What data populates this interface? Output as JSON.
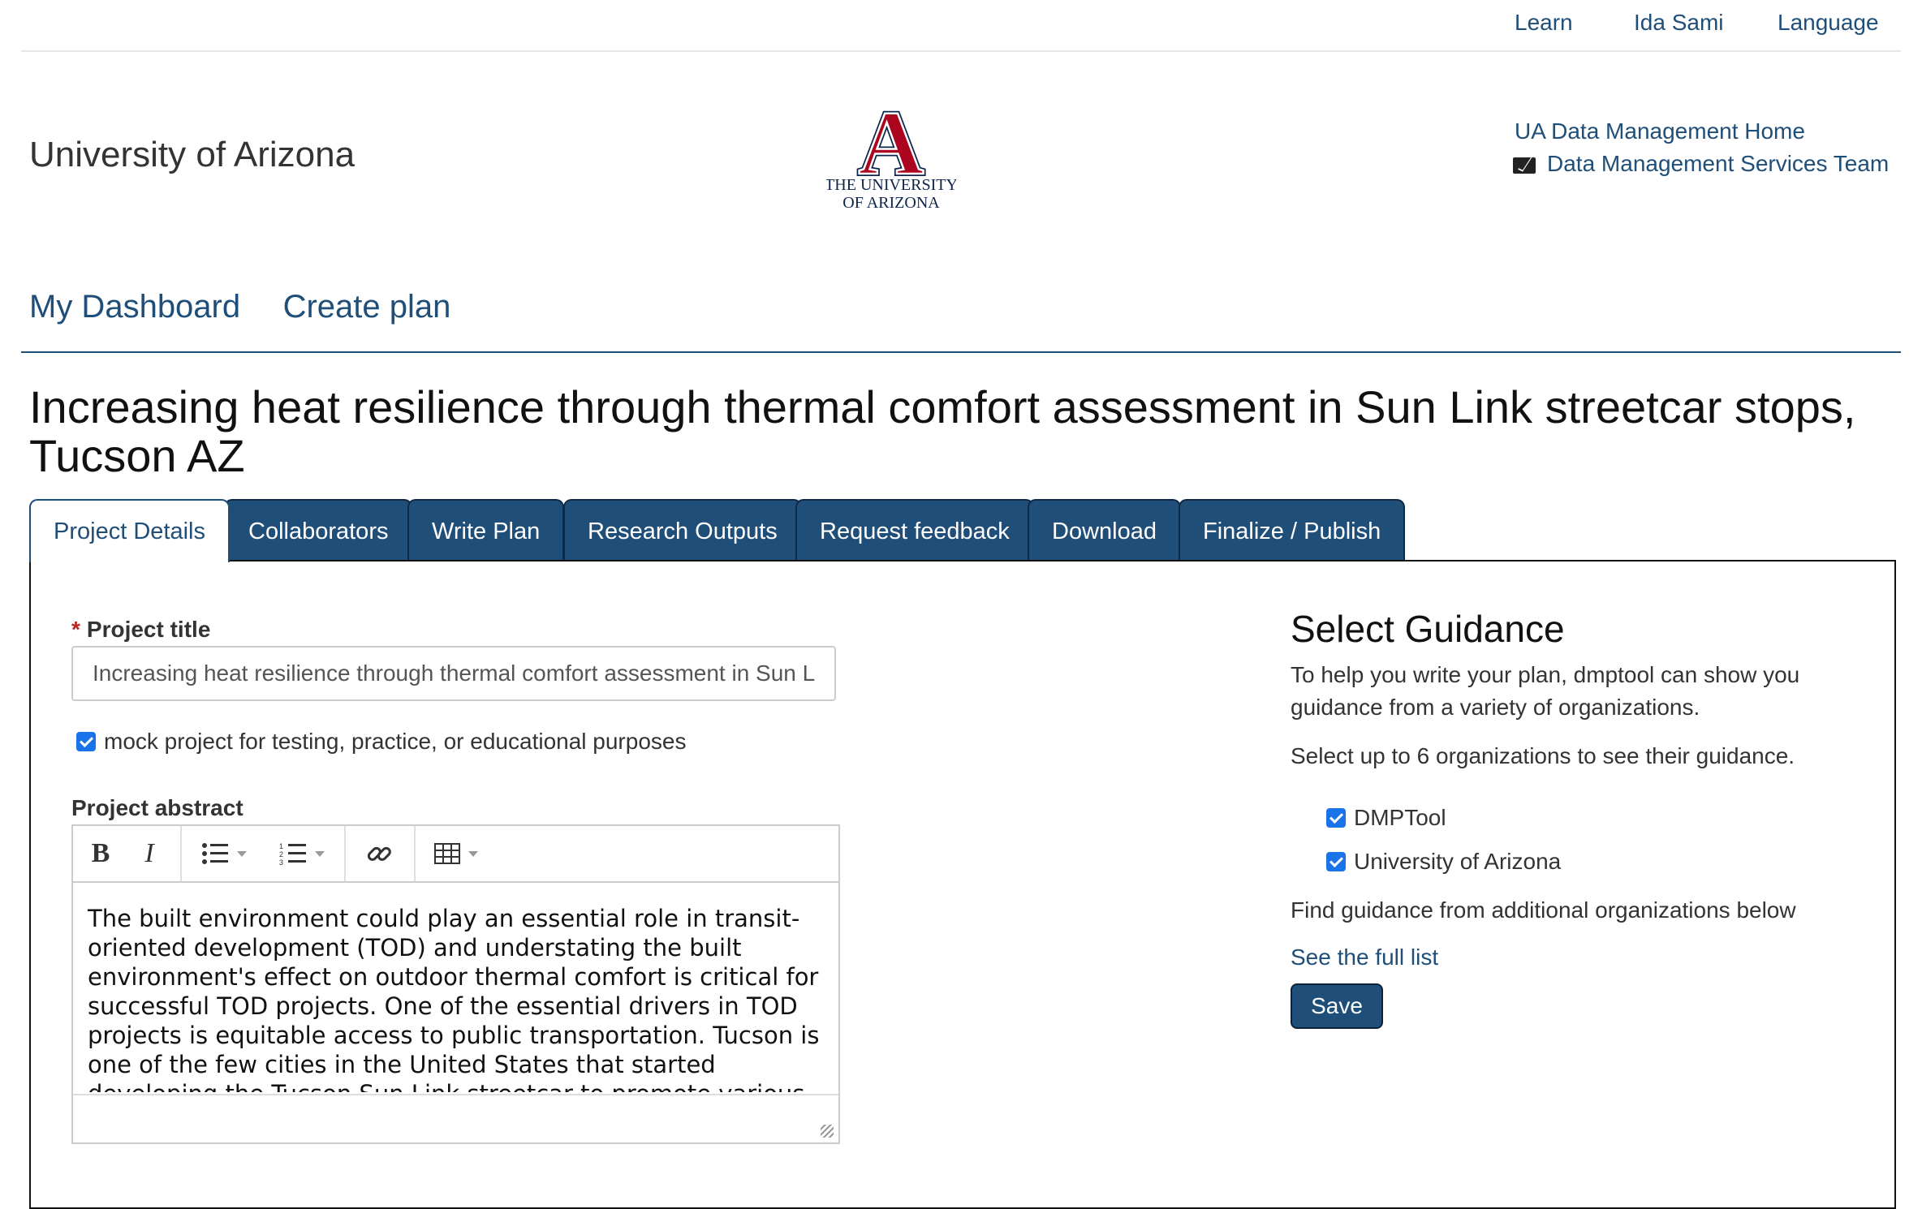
{
  "topbar": {
    "learn": "Learn",
    "user": "Ida Sami",
    "language": "Language"
  },
  "header": {
    "org_name": "University of Arizona",
    "logo_line1": "THE UNIVERSITY",
    "logo_line2": "OF ARIZONA",
    "logo_letter": "A",
    "links": {
      "home": "UA Data Management Home",
      "team": "Data Management Services Team"
    }
  },
  "nav": {
    "dashboard": "My Dashboard",
    "create": "Create plan"
  },
  "plan": {
    "title": "Increasing heat resilience through thermal comfort assessment in Sun Link streetcar stops, Tucson AZ"
  },
  "tabs": [
    {
      "label": "Project Details"
    },
    {
      "label": "Collaborators"
    },
    {
      "label": "Write Plan"
    },
    {
      "label": "Research Outputs"
    },
    {
      "label": "Request feedback"
    },
    {
      "label": "Download"
    },
    {
      "label": "Finalize / Publish"
    }
  ],
  "form": {
    "required_mark": "*",
    "title_label": "Project title",
    "title_value": "Increasing heat resilience through thermal comfort assessment in Sun L",
    "mock_label": "mock project for testing, practice, or educational purposes",
    "mock_checked": true,
    "abstract_label": "Project abstract",
    "abstract_text": "The built environment could play an essential role in transit-oriented development (TOD) and understating the built environment's effect on outdoor thermal comfort is critical for successful TOD projects. One of the essential drivers in TOD projects is equitable access to public transportation. Tucson is one of the few cities in the United States that started developing the Tucson Sun Link streetcar to promote various"
  },
  "guidance": {
    "title": "Select Guidance",
    "intro": "To help you write your plan, dmptool can show you guidance from a variety of organizations.",
    "limit": "Select up to 6 organizations to see their guidance.",
    "options": [
      {
        "label": "DMPTool",
        "checked": true
      },
      {
        "label": "University of Arizona",
        "checked": true
      }
    ],
    "find_more": "Find guidance from additional organizations below",
    "full_list": "See the full list",
    "save": "Save"
  },
  "colors": {
    "brand": "#1f4e79",
    "logo_red": "#ab0520",
    "logo_navy": "#0c234b",
    "checkbox": "#1a73e8"
  }
}
